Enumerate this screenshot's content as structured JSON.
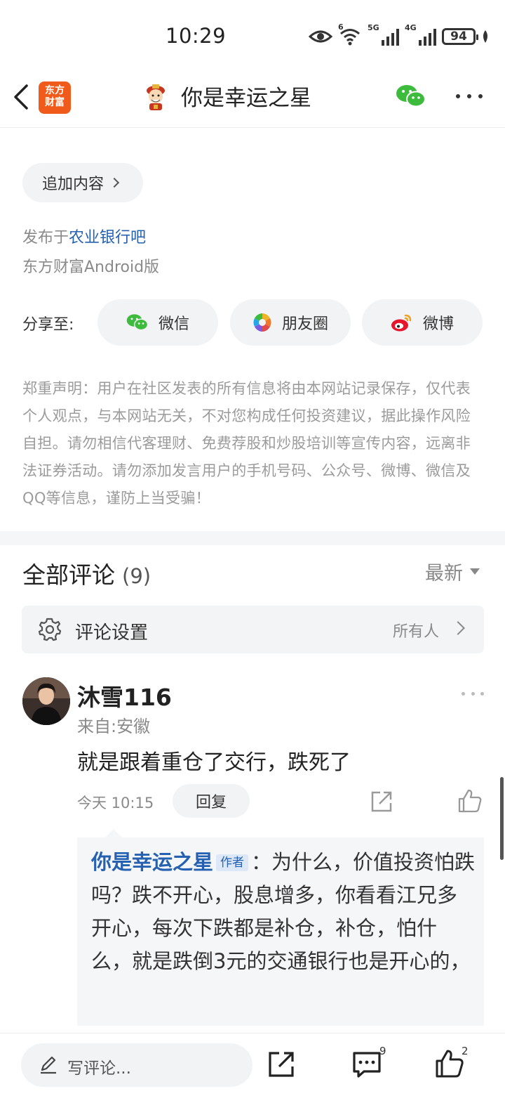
{
  "status_bar": {
    "time": "10:29",
    "network_wifi_label": "6",
    "network_5g_label": "5G",
    "network_4g_label": "4G",
    "battery": "94"
  },
  "nav": {
    "logo_line1": "东方",
    "logo_line2": "财富",
    "title": "你是幸运之星"
  },
  "post": {
    "append_label": "追加内容",
    "published_prefix": "发布于",
    "published_forum": "农业银行吧",
    "via": "东方财富Android版"
  },
  "share": {
    "label": "分享至:",
    "wechat": "微信",
    "moments": "朋友圈",
    "weibo": "微博"
  },
  "disclaimer": "郑重声明：用户在社区发表的所有信息将由本网站记录保存，仅代表个人观点，与本网站无关，不对您构成任何投资建议，据此操作风险自担。请勿相信代客理财、免费荐股和炒股培训等宣传内容，远离非法证券活动。请勿添加发言用户的手机号码、公众号、微博、微信及QQ等信息，谨防上当受骗！",
  "comments": {
    "title": "全部评论",
    "count": "(9)",
    "sort": "最新",
    "settings_label": "评论设置",
    "settings_value": "所有人",
    "items": [
      {
        "name": "沐雪116",
        "location": "来自:安徽",
        "text": "就是跟着重仓了交行，跌死了",
        "time": "今天 10:15",
        "reply_label": "回复",
        "reply": {
          "author": "你是幸运之星",
          "tag": "作者",
          "text": "：为什么，价值投资怕跌吗？跌不开心，股息增多，你看看江兄多开心，每次下跌都是补仓，补仓，怕什么，就是跌倒3元的交通银行也是开心的，"
        }
      }
    ]
  },
  "bottom_bar": {
    "write_placeholder": "写评论...",
    "comment_count": "9",
    "like_count": "2"
  },
  "colors": {
    "link_blue": "#2561b0",
    "brand_orange": "#f05a1a",
    "wechat_green": "#3dbb3d",
    "weibo_red": "#e6162d"
  }
}
